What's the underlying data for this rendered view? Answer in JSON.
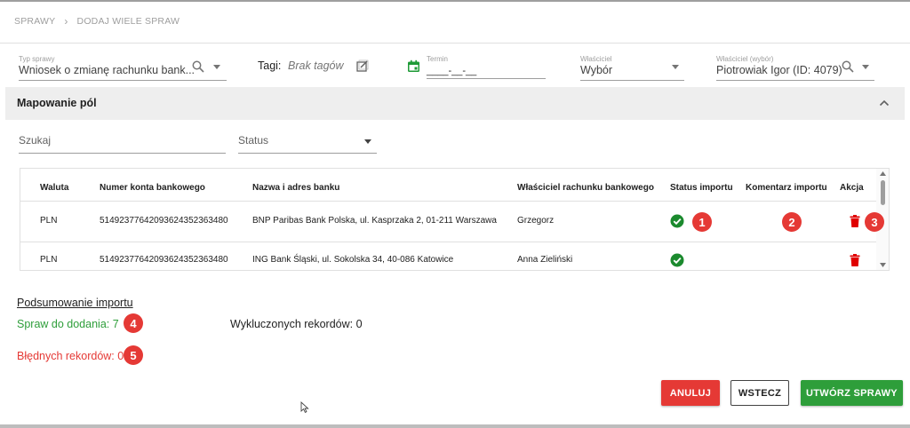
{
  "breadcrumb": {
    "parent": "SPRAWY",
    "current": "DODAJ WIELE SPRAW"
  },
  "filters": {
    "type": {
      "label": "Typ sprawy",
      "value": "Wniosek o zmianę rachunku bank..."
    },
    "tags": {
      "label": "Tagi:",
      "value": "Brak tagów"
    },
    "term": {
      "label": "Termin",
      "value": "____-__-__"
    },
    "owner": {
      "label": "Właściciel",
      "value": "Wybór"
    },
    "owner_pick": {
      "label": "Właściciel (wybór)",
      "value": "Piotrowiak Igor (ID: 4079)"
    }
  },
  "mapping": {
    "title": "Mapowanie pól",
    "search_placeholder": "Szukaj",
    "status_placeholder": "Status"
  },
  "table": {
    "columns": {
      "currency": "Waluta",
      "account": "Numer konta bankowego",
      "bank": "Nazwa i adres banku",
      "holder": "Właściciel rachunku bankowego",
      "status": "Status importu",
      "comment": "Komentarz importu",
      "action": "Akcja"
    },
    "rows": [
      {
        "currency": "PLN",
        "account": "51492377642093624352363480",
        "bank": "BNP Paribas Bank Polska, ul. Kasprzaka 2, 01-211 Warszawa",
        "holder": "Grzegorz"
      },
      {
        "currency": "PLN",
        "account": "51492377642093624352363480",
        "bank": "ING Bank Śląski, ul. Sokolska 34, 40-086 Katowice",
        "holder": "Anna Zieliński"
      }
    ]
  },
  "summary": {
    "title": "Podsumowanie importu",
    "to_add": "Spraw do dodania: 7",
    "excluded": "Wykluczonych rekordów: 0",
    "errors": "Błędnych rekordów: 0"
  },
  "callouts": [
    "1",
    "2",
    "3",
    "4",
    "5"
  ],
  "buttons": {
    "cancel": "ANULUJ",
    "back": "WSTECZ",
    "create": "UTWÓRZ SPRAWY"
  },
  "colors": {
    "accent_red": "#e53935",
    "accent_green": "#2e9e3a",
    "status_ok": "#1b8a2e",
    "error_text": "#e53935",
    "success_text": "#2e9e3a"
  },
  "icons": [
    "chevron-right-icon",
    "search-icon",
    "chevron-down-icon",
    "edit-tags-icon",
    "calendar-icon",
    "chevron-up-icon",
    "check-circle-icon",
    "trash-icon",
    "cursor-icon"
  ]
}
